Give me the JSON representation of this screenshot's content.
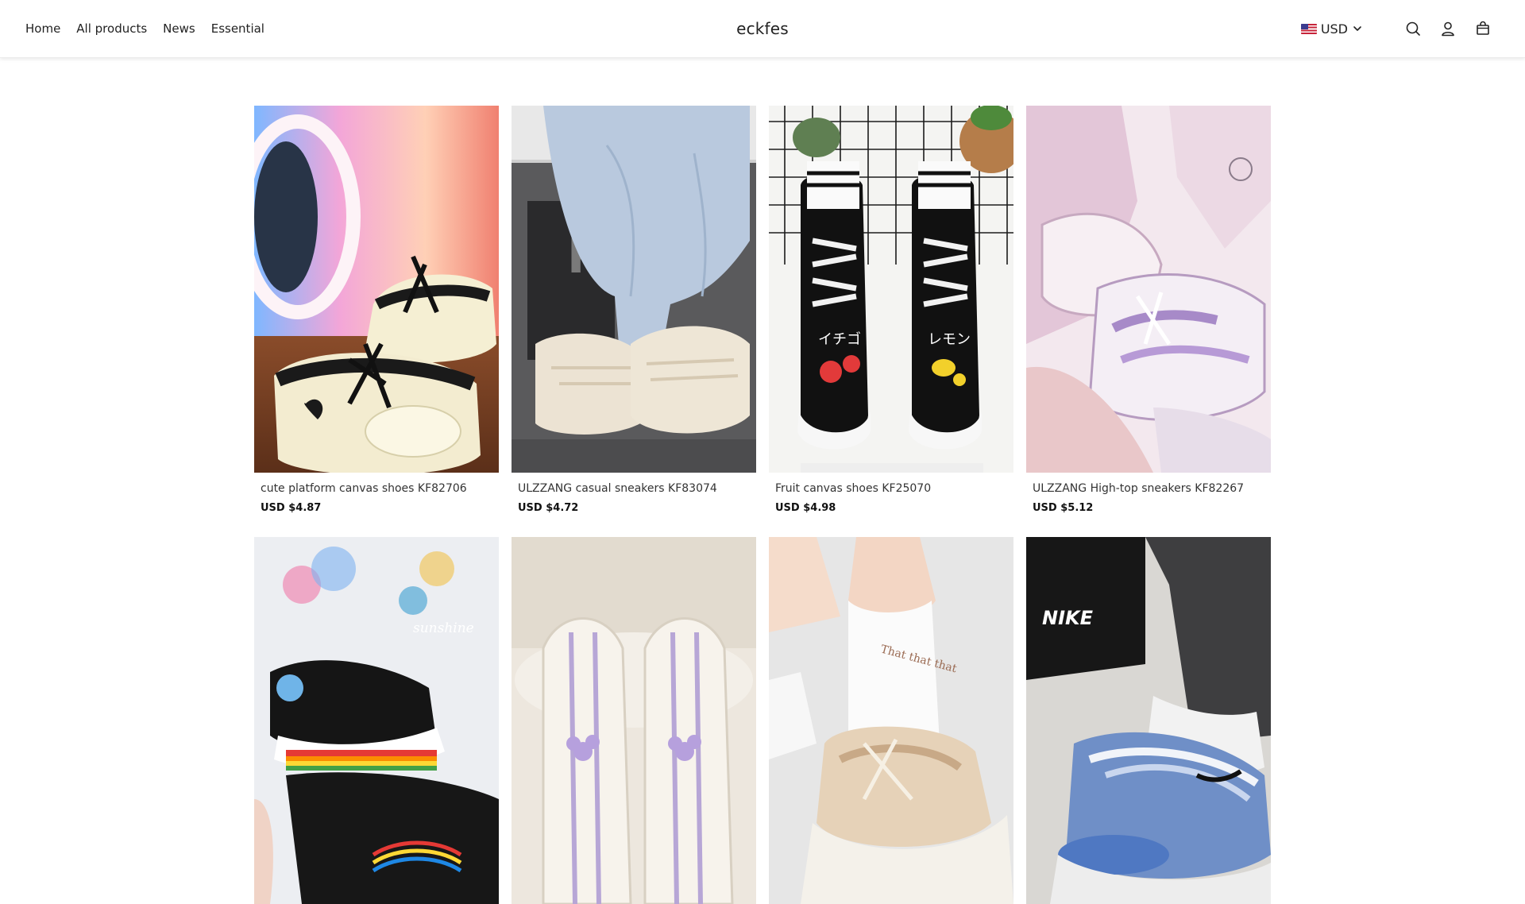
{
  "header": {
    "nav": [
      {
        "label": "Home"
      },
      {
        "label": "All products"
      },
      {
        "label": "News"
      },
      {
        "label": "Essential"
      }
    ],
    "brand": "eckfes",
    "currency": "USD",
    "icons": [
      "search-icon",
      "account-icon",
      "cart-icon"
    ]
  },
  "products": [
    {
      "title": "cute platform canvas shoes KF82706",
      "price": "USD $4.87"
    },
    {
      "title": "ULZZANG casual sneakers KF83074",
      "price": "USD $4.72"
    },
    {
      "title": "Fruit canvas shoes KF25070",
      "price": "USD $4.98"
    },
    {
      "title": "ULZZANG High-top sneakers KF82267",
      "price": "USD $5.12"
    },
    {
      "title": "",
      "price": ""
    },
    {
      "title": "",
      "price": ""
    },
    {
      "title": "",
      "price": ""
    },
    {
      "title": "",
      "price": ""
    }
  ],
  "image_text": {
    "fruit_left": "イチゴ",
    "fruit_right": "レモン",
    "sunshine": "sunshine",
    "brand_bag": "NIKE",
    "sock_text": "That that that"
  }
}
